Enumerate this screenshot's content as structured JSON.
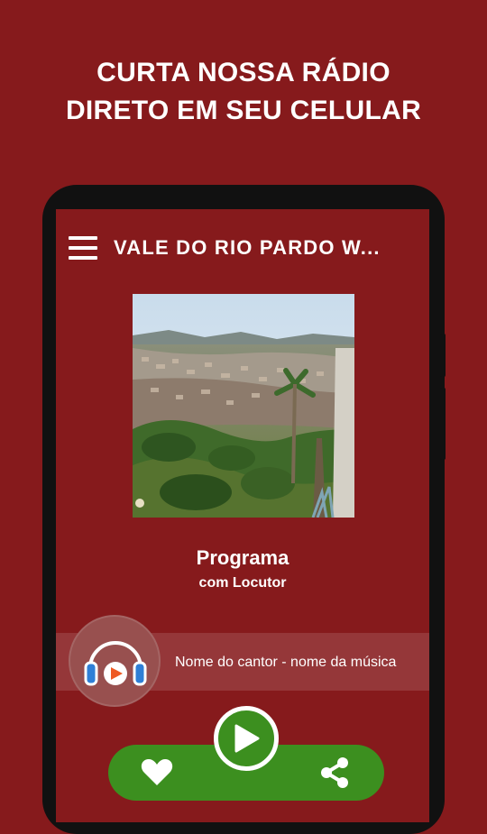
{
  "promo": {
    "line1": "CURTA NOSSA RÁDIO",
    "line2": "DIRETO EM SEU CELULAR"
  },
  "app": {
    "title": "VALE DO RIO PARDO W..."
  },
  "program": {
    "title": "Programa",
    "host": "com Locutor"
  },
  "now_playing": {
    "text": "Nome do cantor - nome da música"
  },
  "icons": {
    "menu": "hamburger-menu-icon",
    "headphones": "headphones-icon",
    "play": "play-icon",
    "favorite": "heart-icon",
    "share": "share-icon"
  },
  "colors": {
    "background": "#861a1c",
    "accent_green": "#3c8f1f",
    "headphone_blue": "#2f7fd6",
    "headphone_orange": "#ee5a24"
  }
}
